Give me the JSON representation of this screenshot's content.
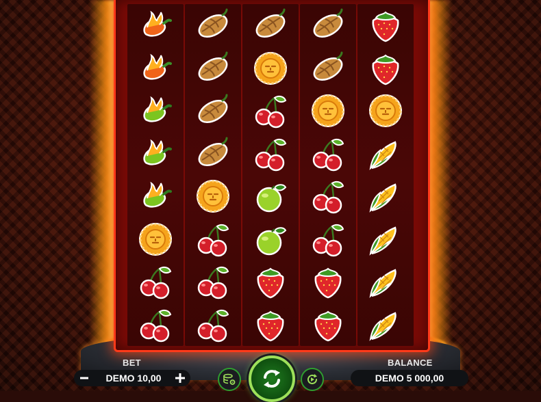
{
  "reels": [
    [
      "chili-red",
      "chili-red",
      "chili-green",
      "chili-green",
      "chili-green",
      "sun-coin",
      "cherry",
      "cherry"
    ],
    [
      "cocoa",
      "cocoa",
      "cocoa",
      "cocoa",
      "sun-coin",
      "cherry",
      "cherry",
      "cherry"
    ],
    [
      "cocoa",
      "sun-coin",
      "cherry",
      "cherry",
      "lime",
      "lime",
      "strawberry",
      "strawberry"
    ],
    [
      "cocoa",
      "cocoa",
      "sun-coin",
      "cherry",
      "cherry",
      "cherry",
      "strawberry",
      "strawberry"
    ],
    [
      "strawberry",
      "strawberry",
      "sun-coin",
      "corn",
      "corn",
      "corn",
      "corn",
      "corn"
    ]
  ],
  "bet": {
    "label": "BET",
    "value": "DEMO 10,00",
    "minus_icon": "minus-icon",
    "plus_icon": "plus-icon"
  },
  "balance": {
    "label": "BALANCE",
    "value": "DEMO 5 000,00"
  },
  "buttons": {
    "settings_icon": "coin-stack-gear-icon",
    "spin_icon": "spin-arrows-icon",
    "autoplay_icon": "autoplay-icon"
  },
  "colors": {
    "frame": "#ff3a1a",
    "accent": "#f29a17",
    "spin": "#2f9e2f"
  }
}
